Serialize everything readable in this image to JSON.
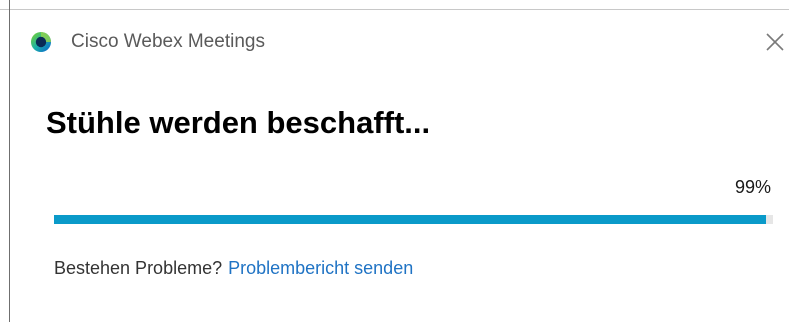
{
  "window": {
    "title": "Cisco Webex Meetings",
    "logo_icon": "webex-logo-icon",
    "close_icon": "close-icon"
  },
  "main": {
    "heading": "Stühle werden beschafft...",
    "progress": {
      "percent_label": "99%",
      "value": 0.99,
      "fill_color": "#0a9ac9",
      "track_color": "#e6e6e6"
    }
  },
  "footer": {
    "question": "Bestehen Probleme?",
    "link_label": "Problembericht senden",
    "link_color": "#1f73c4"
  }
}
